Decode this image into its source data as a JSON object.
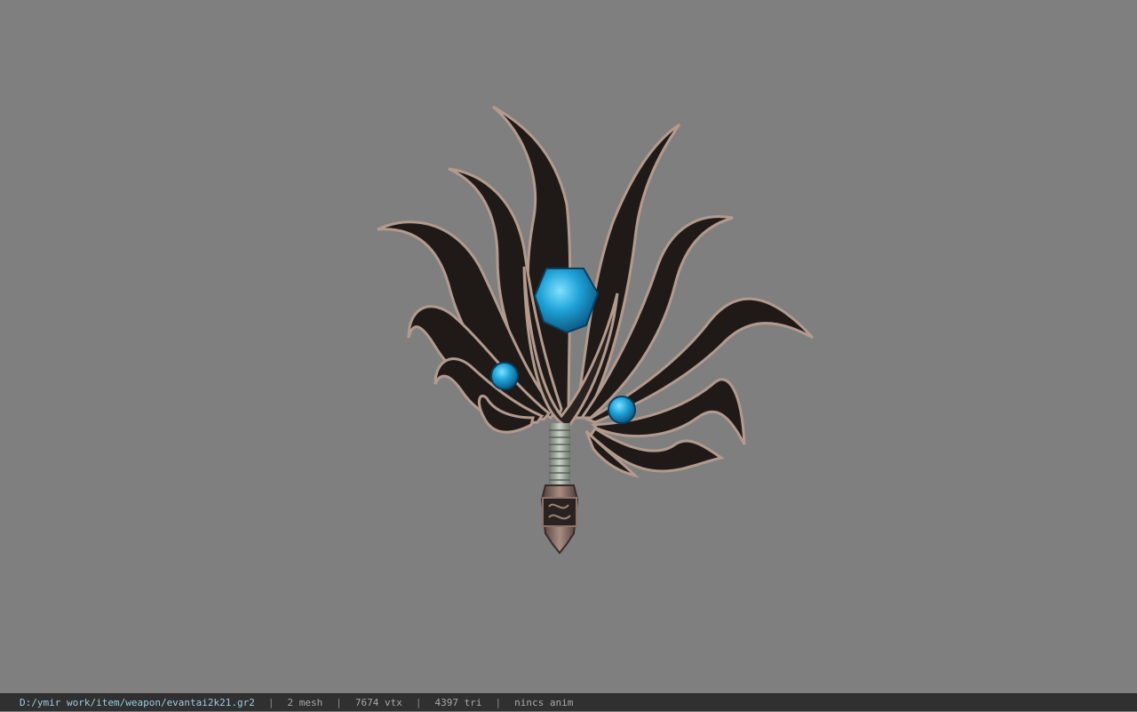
{
  "viewer": {
    "background_color": "#7f7f7f",
    "model_icon": "fan-weapon-model",
    "model_colors": {
      "blade_dark": "#1f1a18",
      "blade_edge": "#b39a8e",
      "gem": "#1fa2d8",
      "handle_wrap": "#9aa29a",
      "handle_metal": "#6b5650"
    }
  },
  "status_bar": {
    "file_path": "D:/ymir work/item/weapon/evantai2k21.gr2",
    "separator": "|",
    "mesh_count": "2 mesh",
    "vertex_count": "7674 vtx",
    "triangle_count": "4397 tri",
    "anim_status": "nincs anim"
  }
}
